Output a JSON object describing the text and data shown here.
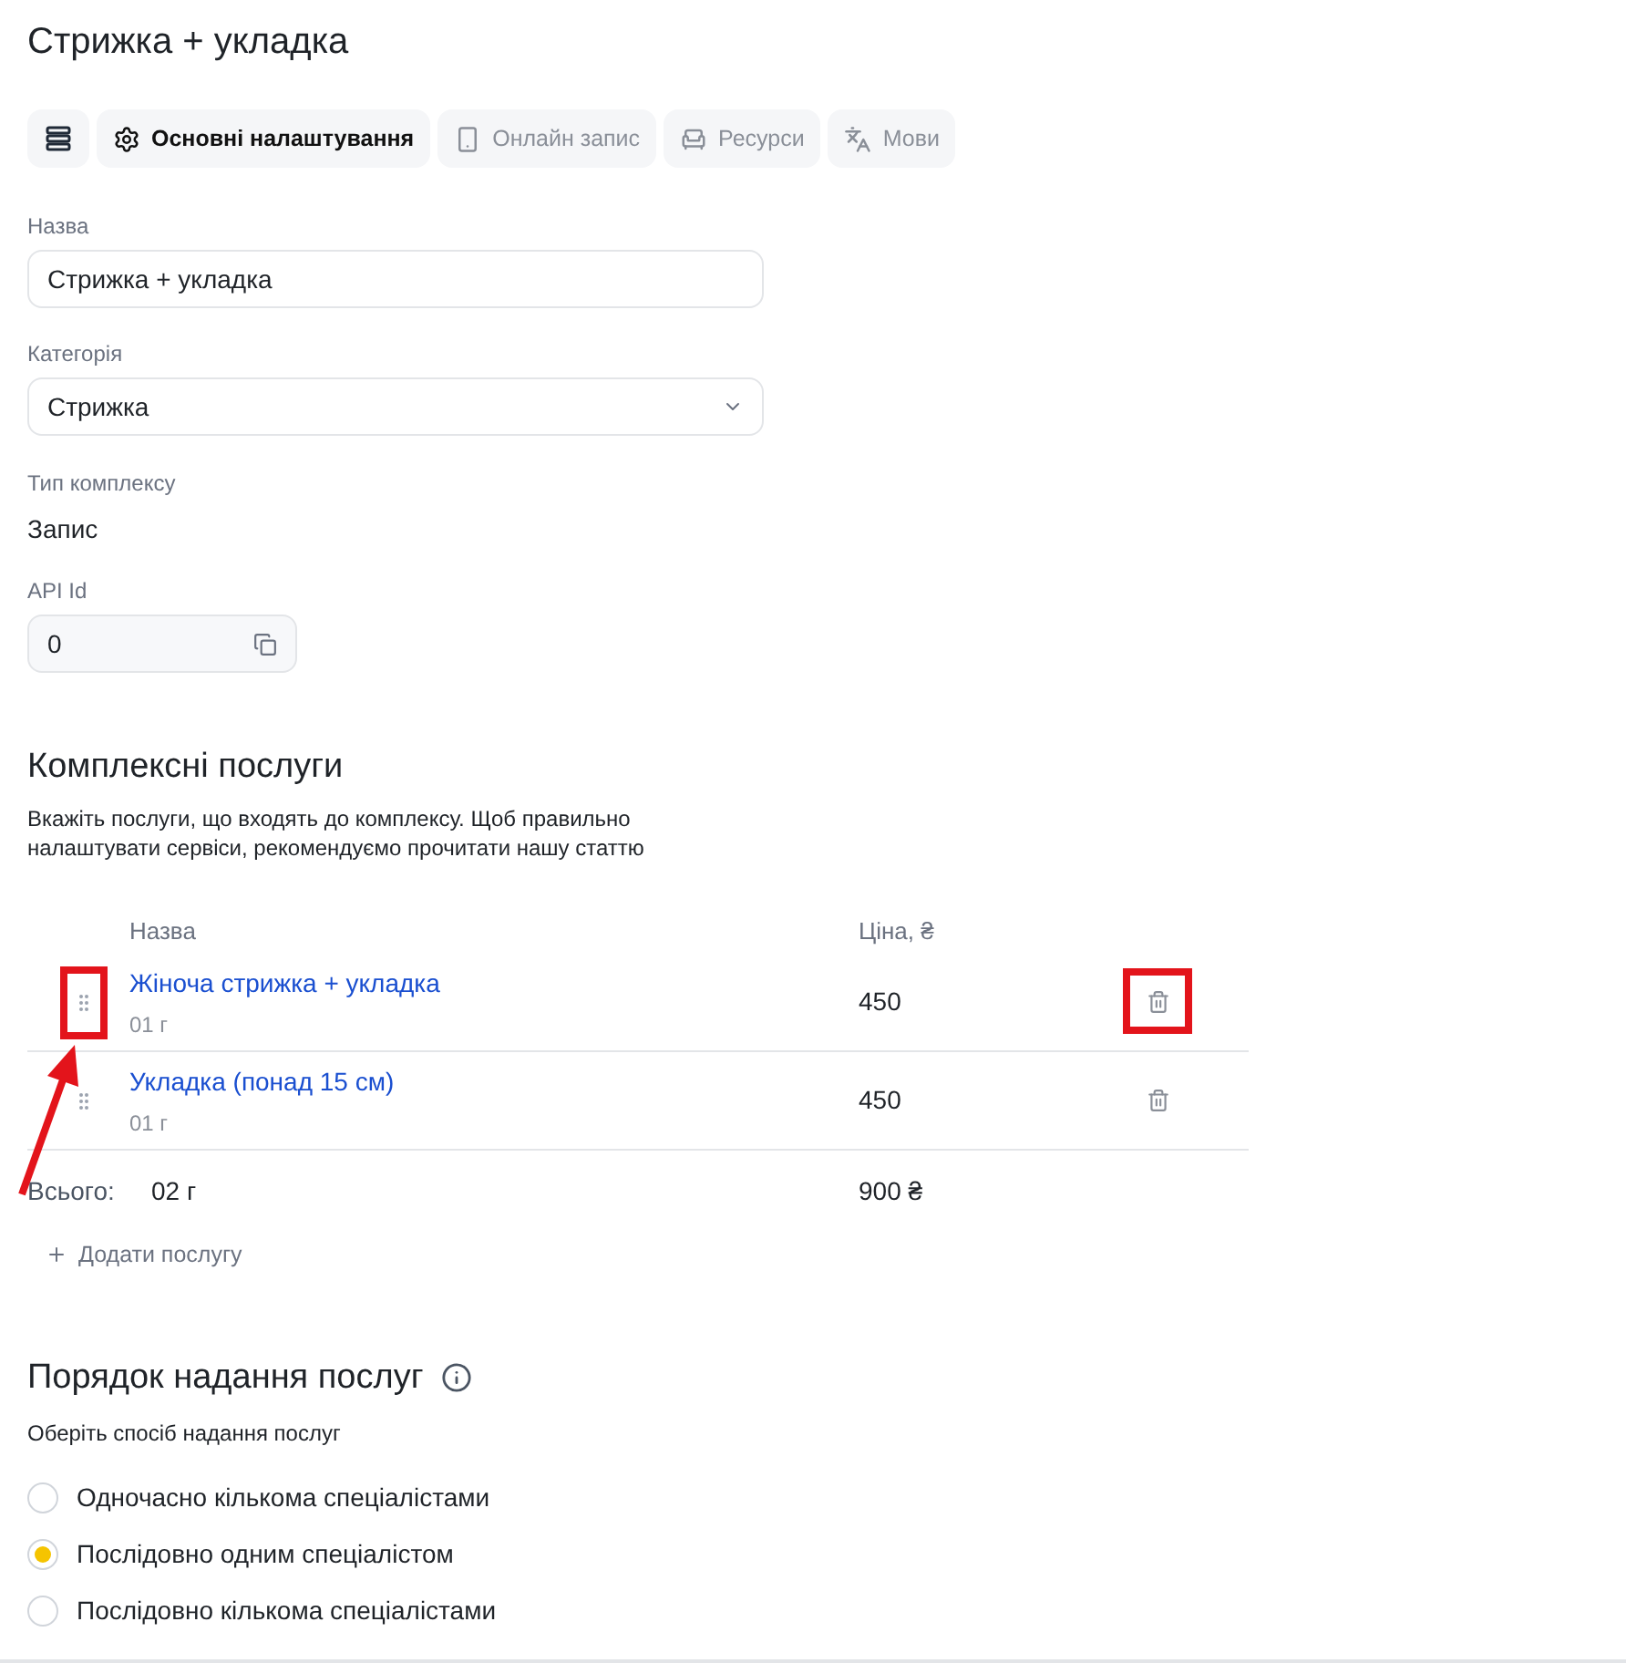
{
  "title": "Стрижка + укладка",
  "tabs": [
    {
      "kind": "stack",
      "selected": false
    },
    {
      "kind": "gear",
      "label": "Основні налаштування",
      "selected": true
    },
    {
      "kind": "phone",
      "label": "Онлайн запис",
      "selected": false
    },
    {
      "kind": "chair",
      "label": "Ресурси",
      "selected": false
    },
    {
      "kind": "translate",
      "label": "Мови",
      "selected": false
    }
  ],
  "form": {
    "name_label": "Назва",
    "name_value": "Стрижка + укладка",
    "category_label": "Категорія",
    "category_value": "Стрижка",
    "type_label": "Тип комплексу",
    "type_value": "Запис",
    "api_label": "API Id",
    "api_value": "0"
  },
  "complex": {
    "heading": "Комплексні послуги",
    "description": "Вкажіть послуги, що входять до комплексу. Щоб правильно налаштувати сервіси, рекомендуємо прочитати нашу статтю",
    "columns": [
      "Назва",
      "Ціна, ₴"
    ],
    "rows": [
      {
        "name": "Жіноча стрижка + укладка",
        "duration": "01 г",
        "price": "450",
        "highlighted": true
      },
      {
        "name": "Укладка (понад 15 см)",
        "duration": "01 г",
        "price": "450"
      }
    ],
    "total_label": "Всього:",
    "total_duration": "02 г",
    "total_price": "900 ₴",
    "add_button": "Додати послугу"
  },
  "order": {
    "heading": "Порядок надання послуг",
    "subtitle": "Оберіть спосіб надання послуг",
    "options": [
      {
        "label": "Одночасно кількома спеціалістами",
        "selected": false
      },
      {
        "label": "Послідовно одним спеціалістом",
        "selected": true
      },
      {
        "label": "Послідовно кількома спеціалістами",
        "selected": false
      }
    ]
  }
}
